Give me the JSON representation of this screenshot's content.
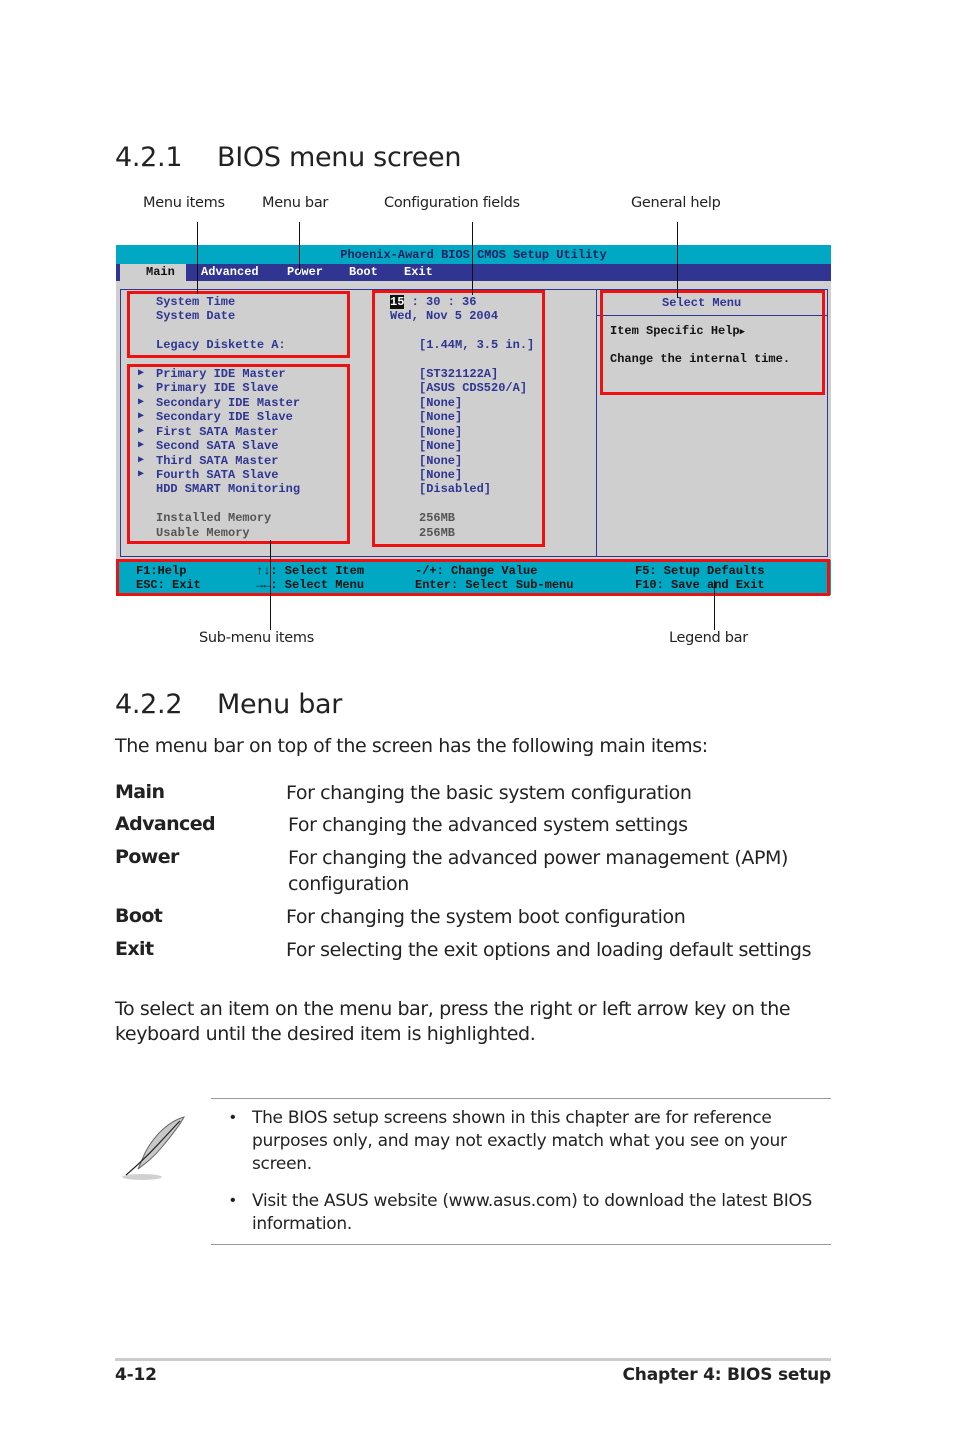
{
  "section1": {
    "number": "4.2.1",
    "title": "BIOS menu screen"
  },
  "callouts": {
    "menu_items": "Menu items",
    "menu_bar": "Menu bar",
    "configuration_fields": "Configuration fields",
    "general_help": "General help",
    "sub_menu_items": "Sub-menu items",
    "legend_bar": "Legend bar"
  },
  "bios": {
    "title": "Phoenix-Award BIOS CMOS Setup Utility",
    "tabs": [
      {
        "label": "Main",
        "active": true
      },
      {
        "label": "Advanced",
        "active": false
      },
      {
        "label": "Power",
        "active": false
      },
      {
        "label": "Boot",
        "active": false
      },
      {
        "label": "Exit",
        "active": false
      }
    ],
    "items": [
      {
        "label": "System Time",
        "value_hl": "15",
        "value": " : 30 : 36"
      },
      {
        "label": "System Date",
        "value": "Wed, Nov 5 2004"
      },
      {
        "label": "Legacy Diskette A:",
        "value": "[1.44M, 3.5 in.]"
      }
    ],
    "submenus": [
      {
        "label": "Primary IDE Master",
        "value": "[ST321122A]"
      },
      {
        "label": "Primary IDE Slave",
        "value": "[ASUS CDS520/A]"
      },
      {
        "label": "Secondary IDE Master",
        "value": "[None]"
      },
      {
        "label": "Secondary IDE Slave",
        "value": "[None]"
      },
      {
        "label": "First SATA Master",
        "value": "[None]"
      },
      {
        "label": "Second SATA Slave",
        "value": "[None]"
      },
      {
        "label": "Third SATA Master",
        "value": "[None]"
      },
      {
        "label": "Fourth SATA Slave",
        "value": "[None]"
      }
    ],
    "hdd_smart": {
      "label": "HDD SMART Monitoring",
      "value": "[Disabled]"
    },
    "memory": [
      {
        "label": "Installed Memory",
        "value": "256MB"
      },
      {
        "label": "Usable Memory",
        "value": "256MB"
      }
    ],
    "help": {
      "title": "Select Menu",
      "item_specific": "Item Specific Help",
      "text": "Change the internal time."
    },
    "legend": {
      "f1": "F1:Help",
      "esc": "ESC: Exit",
      "updown_glyph": "↑↓",
      "updown": ": Select Item",
      "leftright_glyph": "→←",
      "leftright": ": Select Menu",
      "change": "-/+: Change Value",
      "enter": "Enter: Select Sub-menu",
      "f5": "F5: Setup Defaults",
      "f10": "F10: Save and Exit"
    }
  },
  "section2": {
    "number": "4.2.2",
    "title": "Menu bar",
    "intro": "The menu bar on top of the screen has the following main items:",
    "items": [
      {
        "term": "Main",
        "desc": "For changing the basic system configuration"
      },
      {
        "term": "Advanced",
        "desc": "For changing the advanced system settings"
      },
      {
        "term": "Power",
        "desc": "For changing the advanced power management (APM)",
        "desc2": "configuration"
      },
      {
        "term": "Boot",
        "desc": "For changing the system boot configuration"
      },
      {
        "term": "Exit",
        "desc": "For selecting the exit options and loading default settings"
      }
    ],
    "instruction_line1": "To select an item on the menu bar, press the right or left arrow key on the",
    "instruction_line2": "keyboard until the desired item is highlighted."
  },
  "note": {
    "icon": "feather-pen-icon",
    "bullets": [
      {
        "line1": "The BIOS setup screens shown in this chapter are for reference",
        "line2": "purposes only, and may not exactly match what you see on your",
        "line3": "screen."
      },
      {
        "line1": "Visit the ASUS website (www.asus.com) to download the latest BIOS",
        "line2": "information."
      }
    ]
  },
  "footer": {
    "page": "4-12",
    "chapter": "Chapter 4: BIOS setup"
  }
}
